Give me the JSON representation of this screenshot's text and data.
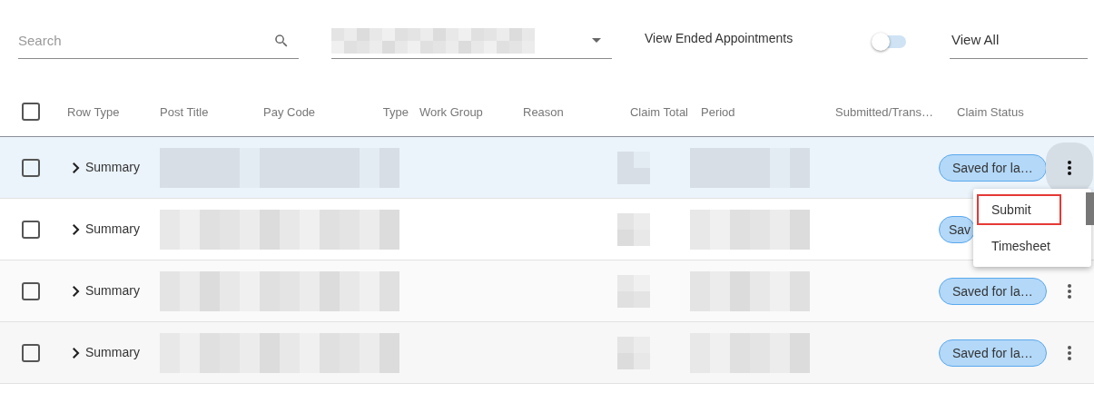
{
  "toolbar": {
    "search": {
      "placeholder": "Search"
    },
    "toggle": {
      "label": "View Ended Appointments",
      "on": false
    },
    "view_select": {
      "value": "View All"
    }
  },
  "table": {
    "columns": [
      "Row Type",
      "Post Title",
      "Pay Code",
      "Type",
      "Work Group",
      "Reason",
      "Claim Total",
      "Period",
      "Submitted/Trans…",
      "Claim Status"
    ],
    "header_checked": false,
    "rows": [
      {
        "checked": false,
        "selected": true,
        "expanded": false,
        "row_type": "Summary",
        "claim_status": "Saved for la…",
        "menu_open": true
      },
      {
        "checked": false,
        "selected": false,
        "expanded": false,
        "row_type": "Summary",
        "claim_status": "Sav",
        "menu_open": false
      },
      {
        "checked": false,
        "selected": false,
        "expanded": false,
        "row_type": "Summary",
        "claim_status": "Saved for la…",
        "menu_open": false
      },
      {
        "checked": false,
        "selected": false,
        "expanded": false,
        "row_type": "Summary",
        "claim_status": "Saved for la…",
        "menu_open": false
      }
    ]
  },
  "row_menu": {
    "items": [
      {
        "label": "Submit",
        "focused": true
      },
      {
        "label": "Timesheet",
        "focused": false
      }
    ]
  }
}
